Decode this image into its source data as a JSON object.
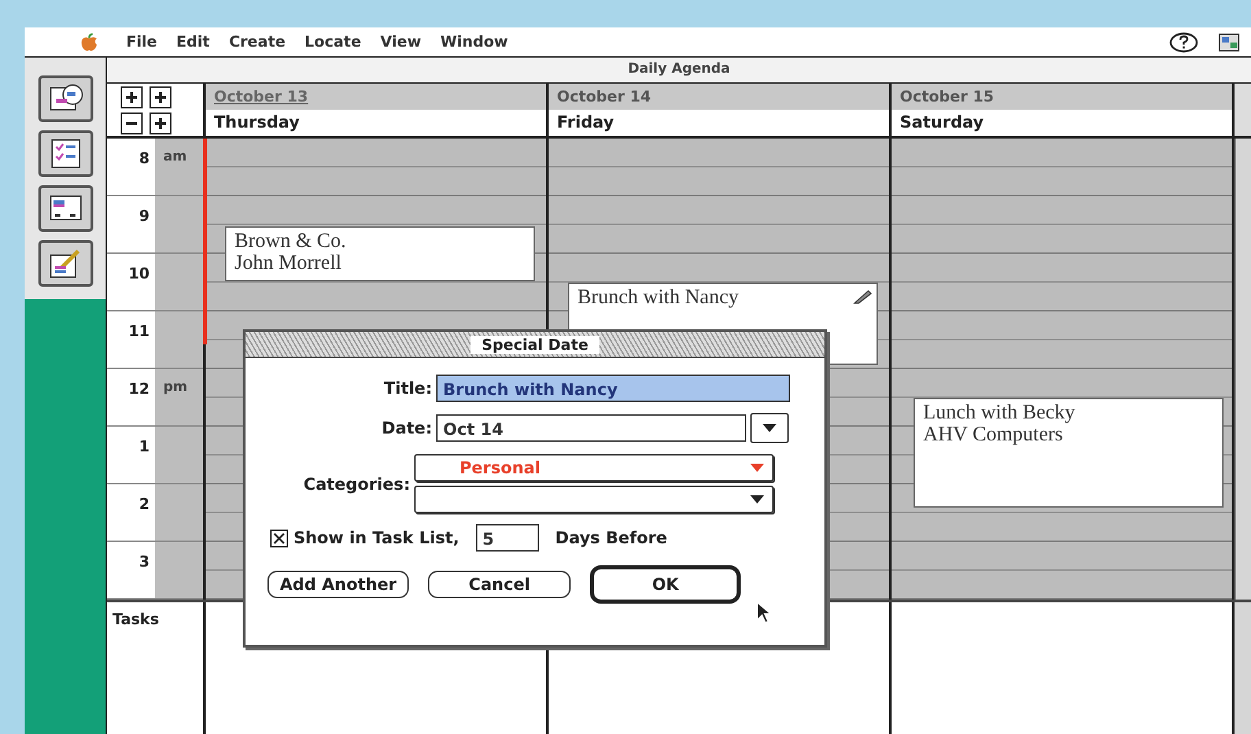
{
  "menu_bar": {
    "items": [
      {
        "label": "File"
      },
      {
        "label": "Edit"
      },
      {
        "label": "Create"
      },
      {
        "label": "Locate"
      },
      {
        "label": "View"
      },
      {
        "label": "Window"
      }
    ]
  },
  "window": {
    "title": "Daily Agenda"
  },
  "days": [
    {
      "date": "October 13",
      "weekday": "Thursday",
      "selected": true,
      "appointments": [
        {
          "lines": [
            "Brown & Co.",
            "John Morrell"
          ],
          "editing": false
        }
      ]
    },
    {
      "date": "October 14",
      "weekday": "Friday",
      "selected": false,
      "appointments": [
        {
          "lines": [
            "Brunch with Nancy"
          ],
          "editing": true
        }
      ]
    },
    {
      "date": "October 15",
      "weekday": "Saturday",
      "selected": false,
      "appointments": [
        {
          "lines": [
            "Lunch with Becky",
            "AHV Computers"
          ],
          "editing": false
        }
      ]
    }
  ],
  "hours": [
    {
      "hour": "8",
      "period": "am"
    },
    {
      "hour": "9"
    },
    {
      "hour": "10"
    },
    {
      "hour": "11"
    },
    {
      "hour": "12",
      "period": "pm"
    },
    {
      "hour": "1"
    },
    {
      "hour": "2"
    },
    {
      "hour": "3"
    }
  ],
  "tasks_label": "Tasks",
  "dialog": {
    "title": "Special Date",
    "title_label": "Title:",
    "title_value": "Brunch with Nancy",
    "date_label": "Date:",
    "date_value": "Oct 14",
    "categories_label": "Categories:",
    "categories": [
      {
        "kind": "popup",
        "value": "Personal",
        "color": "#e8402a"
      },
      {
        "kind": "popup"
      }
    ],
    "task_checkbox": {
      "label": "Show in Task List,",
      "checked": true
    },
    "days_value": "5",
    "days_label": "Days Before",
    "buttons": [
      {
        "label": "Add Another",
        "default": false
      },
      {
        "label": "Cancel",
        "default": false
      },
      {
        "label": "OK",
        "default": true
      }
    ]
  }
}
